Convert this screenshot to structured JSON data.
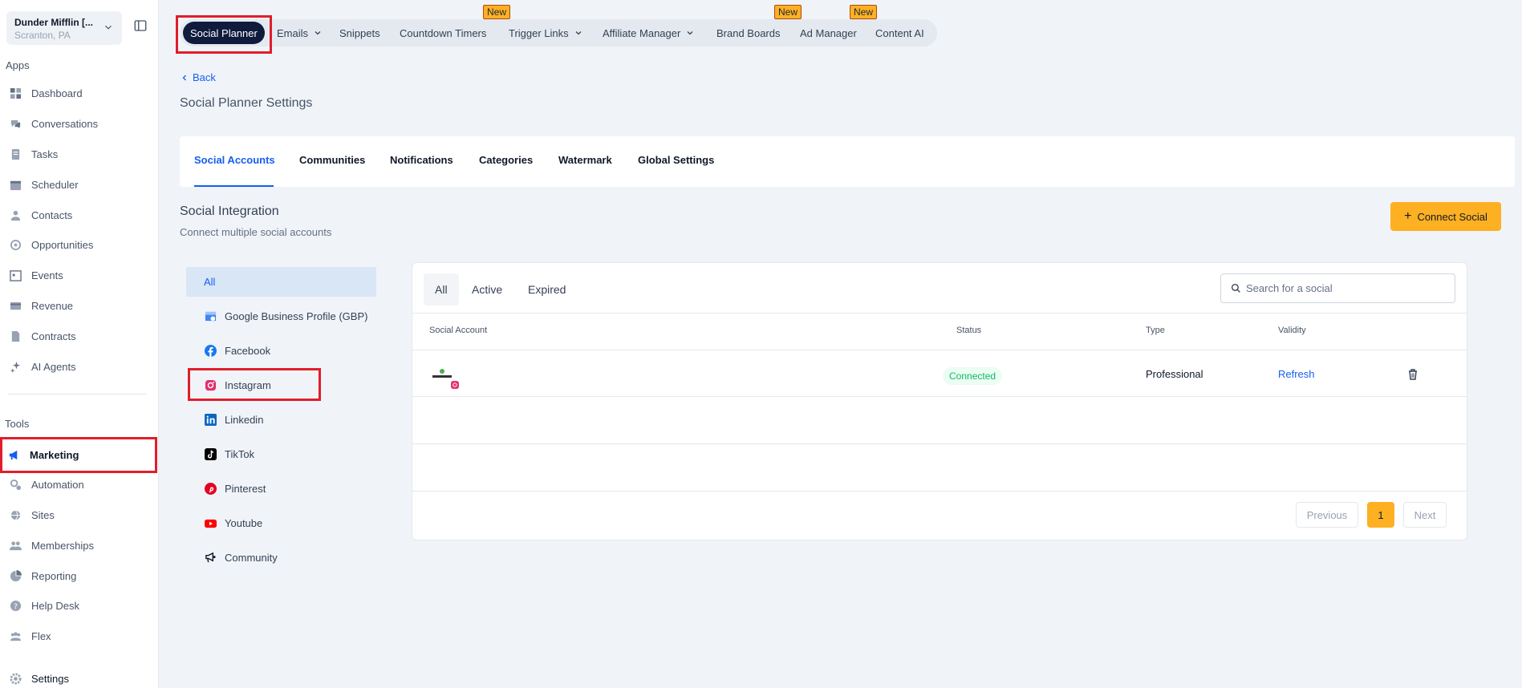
{
  "location": {
    "name": "Dunder Mifflin [...",
    "subtitle": "Scranton, PA"
  },
  "sidebar": {
    "apps_label": "Apps",
    "tools_label": "Tools",
    "apps": [
      {
        "label": "Dashboard",
        "icon": "dashboard-icon"
      },
      {
        "label": "Conversations",
        "icon": "conversations-icon"
      },
      {
        "label": "Tasks",
        "icon": "tasks-icon"
      },
      {
        "label": "Scheduler",
        "icon": "calendar-icon"
      },
      {
        "label": "Contacts",
        "icon": "contacts-icon"
      },
      {
        "label": "Opportunities",
        "icon": "opportunities-icon"
      },
      {
        "label": "Events",
        "icon": "events-icon"
      },
      {
        "label": "Revenue",
        "icon": "revenue-icon"
      },
      {
        "label": "Contracts",
        "icon": "contracts-icon"
      },
      {
        "label": "AI Agents",
        "icon": "ai-agents-icon"
      }
    ],
    "tools": [
      {
        "label": "Marketing",
        "icon": "megaphone-icon",
        "active": true
      },
      {
        "label": "Automation",
        "icon": "automation-icon"
      },
      {
        "label": "Sites",
        "icon": "sites-icon"
      },
      {
        "label": "Memberships",
        "icon": "memberships-icon"
      },
      {
        "label": "Reporting",
        "icon": "reporting-icon"
      },
      {
        "label": "Help Desk",
        "icon": "help-desk-icon"
      },
      {
        "label": "Flex",
        "icon": "flex-icon"
      }
    ],
    "settings_label": "Settings"
  },
  "topnav": {
    "items": [
      {
        "label": "Social Planner",
        "active": true
      },
      {
        "label": "Emails",
        "dropdown": true
      },
      {
        "label": "Snippets"
      },
      {
        "label": "Countdown Timers",
        "badge": "New"
      },
      {
        "label": "Trigger Links",
        "dropdown": true
      },
      {
        "label": "Affiliate Manager",
        "dropdown": true
      },
      {
        "label": "Brand Boards",
        "badge": "New"
      },
      {
        "label": "Ad Manager",
        "badge": "New"
      },
      {
        "label": "Content AI"
      }
    ]
  },
  "header": {
    "back_label": "Back",
    "title": "Social Planner Settings"
  },
  "tabs": [
    {
      "label": "Social Accounts",
      "active": true
    },
    {
      "label": "Communities"
    },
    {
      "label": "Notifications"
    },
    {
      "label": "Categories"
    },
    {
      "label": "Watermark"
    },
    {
      "label": "Global Settings"
    }
  ],
  "integration": {
    "title": "Social Integration",
    "subtitle": "Connect multiple social accounts",
    "connect_button": "Connect Social"
  },
  "filters": [
    {
      "label": "All",
      "selected": true
    },
    {
      "label": "Google Business Profile (GBP)",
      "icon": "google-business-icon"
    },
    {
      "label": "Facebook",
      "icon": "facebook-icon"
    },
    {
      "label": "Instagram",
      "icon": "instagram-icon"
    },
    {
      "label": "Linkedin",
      "icon": "linkedin-icon"
    },
    {
      "label": "TikTok",
      "icon": "tiktok-icon"
    },
    {
      "label": "Pinterest",
      "icon": "pinterest-icon"
    },
    {
      "label": "Youtube",
      "icon": "youtube-icon"
    },
    {
      "label": "Community",
      "icon": "community-icon"
    }
  ],
  "status_tabs": [
    {
      "label": "All",
      "selected": true
    },
    {
      "label": "Active"
    },
    {
      "label": "Expired"
    }
  ],
  "search": {
    "placeholder": "Search for a social",
    "value": ""
  },
  "table": {
    "headers": [
      "Social Account",
      "Status",
      "Type",
      "Validity"
    ],
    "rows": [
      {
        "account_icon": "instagram-icon",
        "status": "Connected",
        "type": "Professional",
        "validity": "Refresh"
      }
    ]
  },
  "pagination": {
    "previous": "Previous",
    "current": "1",
    "next": "Next"
  },
  "colors": {
    "accent": "#155eef",
    "brand_yellow": "#fdb022",
    "nav_dark": "#0f1b3d",
    "highlight_red": "#e11d2b",
    "connected_green": "#12b76a"
  }
}
